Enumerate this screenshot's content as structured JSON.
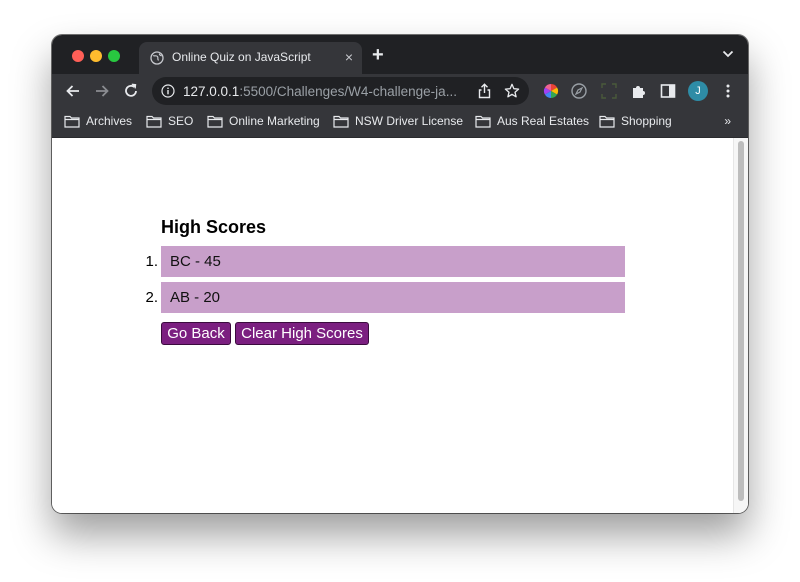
{
  "browser": {
    "tab_title": "Online Quiz on JavaScript",
    "tab_close": "×",
    "new_tab": "+",
    "url_host": "127.0.0.1",
    "url_rest": ":5500/Challenges/W4-challenge-ja...",
    "avatar_letter": "J",
    "bookmarks": [
      {
        "label": "Archives"
      },
      {
        "label": "SEO"
      },
      {
        "label": "Online Marketing"
      },
      {
        "label": "NSW Driver License"
      },
      {
        "label": "Aus Real Estates"
      },
      {
        "label": "Shopping"
      }
    ],
    "bookmarks_more": "»",
    "icons": [
      "globe-icon",
      "close-icon",
      "plus-icon",
      "chevron-down-icon",
      "back-arrow-icon",
      "forward-arrow-icon",
      "reload-icon",
      "info-icon",
      "share-icon",
      "star-icon",
      "color-wheel-icon",
      "compass-icon",
      "screenshot-icon",
      "puzzle-icon",
      "sidebar-icon",
      "kebab-menu-icon",
      "folder-icon"
    ],
    "colors": {
      "tab_strip": "#202124",
      "toolbar": "#35363a",
      "text": "#e8eaed",
      "avatar": "#2e8ca6"
    }
  },
  "page": {
    "title": "High Scores",
    "scores": [
      {
        "rank": "1.",
        "text": "BC - 45"
      },
      {
        "rank": "2.",
        "text": "AB - 20"
      }
    ],
    "go_back_label": "Go Back",
    "clear_label": "Clear High Scores",
    "colors": {
      "score_row": "#c89fca",
      "button": "#7b1f80",
      "button_text": "#ffffff"
    }
  }
}
